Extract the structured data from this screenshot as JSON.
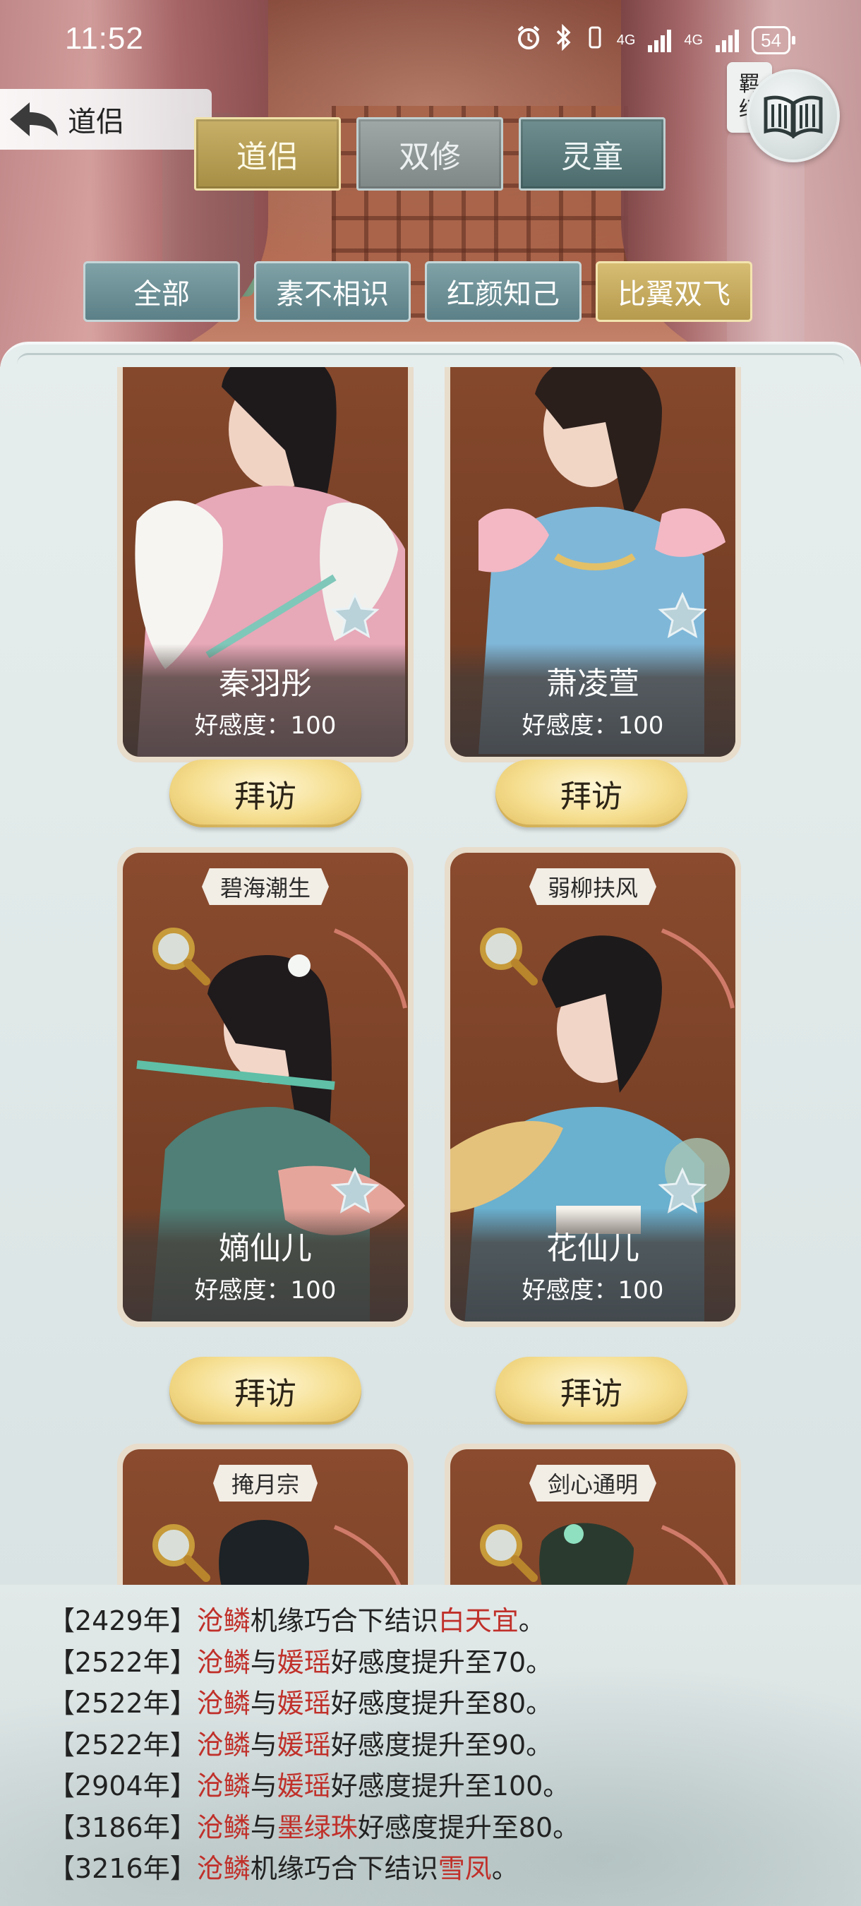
{
  "status_bar": {
    "time": "11:52",
    "network_1": "4G",
    "network_2": "4G",
    "battery": "54"
  },
  "header": {
    "back_title": "道侣",
    "bond_label_1": "羁",
    "bond_label_2": "绊"
  },
  "main_tabs": [
    {
      "label": "道侣",
      "active": true
    },
    {
      "label": "双修",
      "active": false
    },
    {
      "label": "灵童",
      "active": false
    }
  ],
  "filter_tabs": [
    {
      "label": "全部",
      "active": false
    },
    {
      "label": "素不相识",
      "active": false
    },
    {
      "label": "红颜知己",
      "active": false
    },
    {
      "label": "比翼双飞",
      "active": true
    }
  ],
  "cards": [
    {
      "name": "秦羽彤",
      "favor": "好感度：100",
      "tag": "",
      "visit": "拜访"
    },
    {
      "name": "萧凌萱",
      "favor": "好感度：100",
      "tag": "",
      "visit": "拜访"
    },
    {
      "name": "嫡仙儿",
      "favor": "好感度：100",
      "tag": "碧海潮生",
      "visit": "拜访"
    },
    {
      "name": "花仙儿",
      "favor": "好感度：100",
      "tag": "弱柳扶风",
      "visit": "拜访"
    },
    {
      "name": "",
      "favor": "",
      "tag": "掩月宗",
      "visit": ""
    },
    {
      "name": "",
      "favor": "",
      "tag": "剑心通明",
      "visit": ""
    }
  ],
  "colors": {
    "tab_active": "#c8b068",
    "tab_inactive": "#6f8e8f",
    "log_name": "#c0302a",
    "visit_button": "#f5de8f"
  },
  "log": [
    {
      "year": "【2429年】",
      "actor": "沧鳞",
      "mid": "机缘巧合下结识",
      "target": "白天宜",
      "end": "。"
    },
    {
      "year": "【2522年】",
      "actor": "沧鳞",
      "mid": "与",
      "target": "媛瑶",
      "end": "好感度提升至70。"
    },
    {
      "year": "【2522年】",
      "actor": "沧鳞",
      "mid": "与",
      "target": "媛瑶",
      "end": "好感度提升至80。"
    },
    {
      "year": "【2522年】",
      "actor": "沧鳞",
      "mid": "与",
      "target": "媛瑶",
      "end": "好感度提升至90。"
    },
    {
      "year": "【2904年】",
      "actor": "沧鳞",
      "mid": "与",
      "target": "媛瑶",
      "end": "好感度提升至100。"
    },
    {
      "year": "【3186年】",
      "actor": "沧鳞",
      "mid": "与",
      "target": "墨绿珠",
      "end": "好感度提升至80。"
    },
    {
      "year": "【3216年】",
      "actor": "沧鳞",
      "mid": "机缘巧合下结识",
      "target": "雪凤",
      "end": "。"
    }
  ]
}
